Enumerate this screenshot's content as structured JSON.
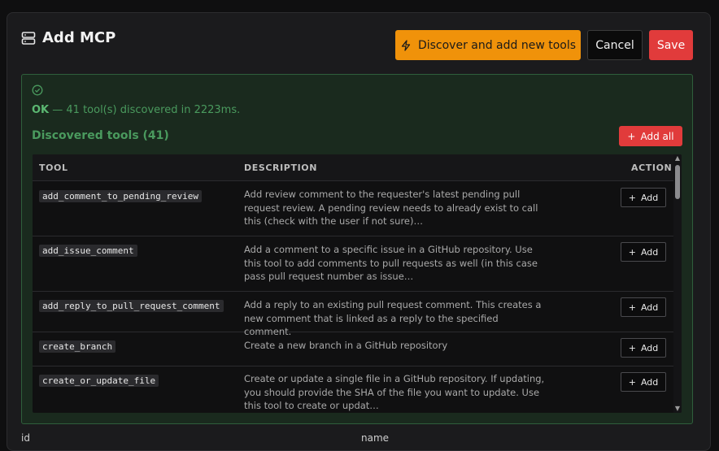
{
  "header": {
    "title": "Add MCP",
    "discover_label": "Discover and add new tools",
    "cancel_label": "Cancel",
    "save_label": "Save"
  },
  "status": {
    "ok_label": "OK",
    "message": " — 41 tool(s) discovered in 2223ms."
  },
  "discovered": {
    "title": "Discovered tools (41)",
    "add_all_label": "Add all"
  },
  "table": {
    "columns": [
      "TOOL",
      "DESCRIPTION",
      "ACTION"
    ],
    "rows": [
      {
        "tool": "add_comment_to_pending_review",
        "description": "Add review comment to the requester's latest pending pull request review. A pending review needs to already exist to call this (check with the user if not sure)…",
        "action": "Add"
      },
      {
        "tool": "add_issue_comment",
        "description": "Add a comment to a specific issue in a GitHub repository. Use this tool to add comments to pull requests as well (in this case pass pull request number as issue…",
        "action": "Add"
      },
      {
        "tool": "add_reply_to_pull_request_comment",
        "description": "Add a reply to an existing pull request comment. This creates a new comment that is linked as a reply to the specified comment.",
        "action": "Add"
      },
      {
        "tool": "create_branch",
        "description": "Create a new branch in a GitHub repository",
        "action": "Add"
      },
      {
        "tool": "create_or_update_file",
        "description": "Create or update a single file in a GitHub repository. If updating, you should provide the SHA of the file you want to update. Use this tool to create or updat…",
        "action": "Add"
      }
    ]
  },
  "footer": {
    "left_label": "id",
    "mid_label": "name"
  },
  "colors": {
    "accent_orange": "#f0920a",
    "danger_red": "#e13b3b",
    "success_green": "#4a9a5e"
  },
  "icons": {
    "title": "server-icon",
    "discover": "lightning-icon",
    "status": "check-circle-icon",
    "add": "plus-icon"
  }
}
